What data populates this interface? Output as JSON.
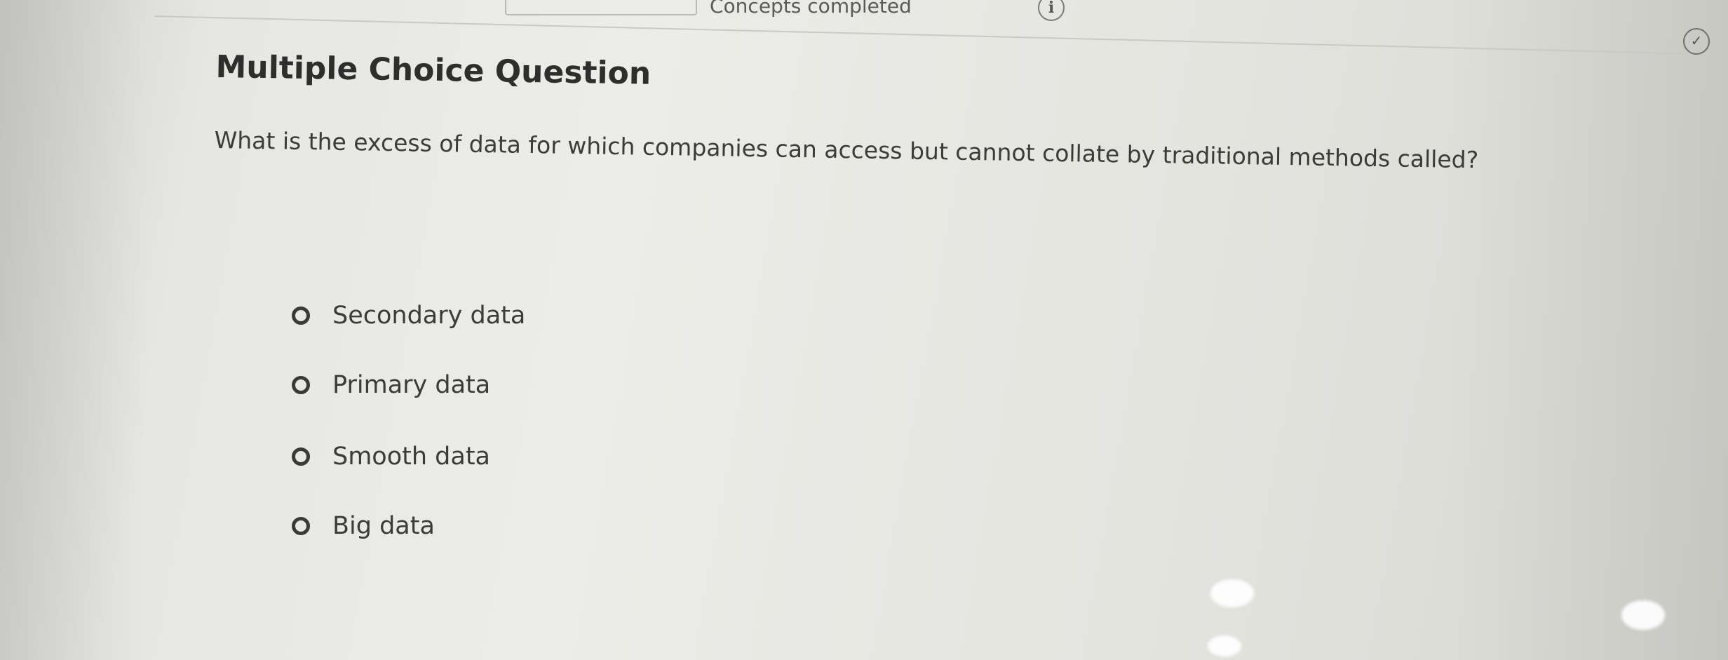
{
  "header": {
    "progress_text": "Concepts completed",
    "info_icon": "info-icon",
    "check_icon": "check-circle-icon"
  },
  "question": {
    "type_title": "Multiple Choice Question",
    "text": "What is the excess of data for which companies can access but cannot collate by traditional methods called?",
    "options": [
      {
        "label": "Secondary data",
        "selected": false
      },
      {
        "label": "Primary data",
        "selected": false
      },
      {
        "label": "Smooth data",
        "selected": false
      },
      {
        "label": "Big data",
        "selected": false
      }
    ]
  },
  "colors": {
    "text": "#3b3b3b",
    "title": "#2e2e2e",
    "background": "#e6e6e2"
  }
}
